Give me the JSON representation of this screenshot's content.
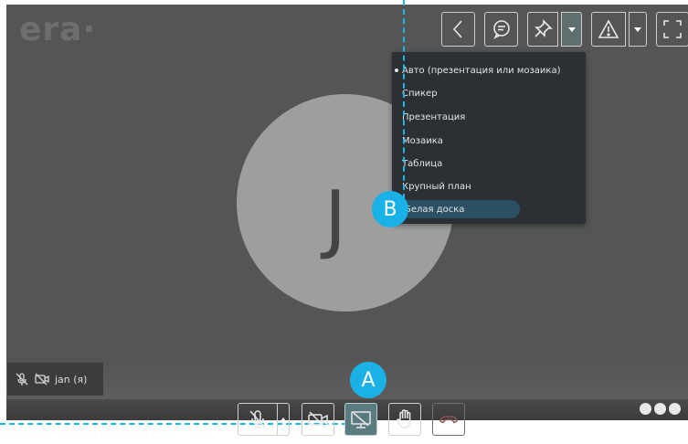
{
  "app": {
    "logo": "era·",
    "avatar_initial": "J"
  },
  "toolbar": {
    "icons": [
      "back-icon",
      "chat-icon",
      "layout-pin-icon",
      "warning-icon",
      "fullscreen-icon"
    ]
  },
  "layout_menu": {
    "selected": "Авто (презентация или мозаика)",
    "items": [
      {
        "label": "Авто (презентация или мозаика)",
        "selected": true
      },
      {
        "label": "Спикер"
      },
      {
        "label": "Презентация"
      },
      {
        "label": "Мозаика"
      },
      {
        "label": "Таблица"
      },
      {
        "label": "Крупный план"
      },
      {
        "label": "Белая доска",
        "highlighted": true
      }
    ]
  },
  "participant": {
    "name": "jan (я)"
  },
  "controls": {
    "buttons": [
      "mic-muted-icon",
      "camera-off-icon",
      "screen-share-icon",
      "raise-hand-icon",
      "hang-up-icon"
    ],
    "screen_share_active": true
  },
  "annotations": {
    "callout_a": "A",
    "callout_b": "B",
    "accent_color": "#1ab2e6"
  },
  "colors": {
    "background": "#555555",
    "menu_bg": "#2c2f33",
    "menu_highlight": "#2b5064",
    "active_button": "#5a7b80"
  }
}
